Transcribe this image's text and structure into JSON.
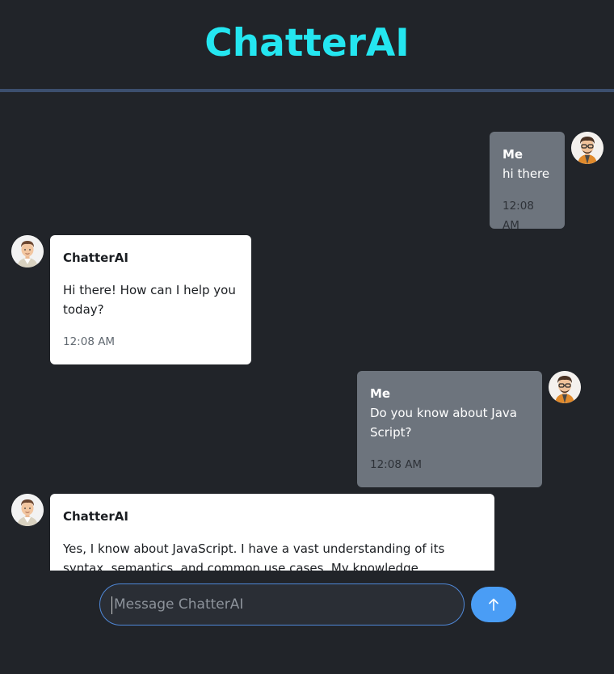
{
  "app": {
    "title": "ChatterAI"
  },
  "messages": [
    {
      "sender": "Me",
      "text": "hi there",
      "time": "12:08 AM",
      "role": "user"
    },
    {
      "sender": "ChatterAI",
      "text": "Hi there! How can I help you today?",
      "time": "12:08 AM",
      "role": "bot"
    },
    {
      "sender": "Me",
      "text": "Do you know about Java Script?",
      "time": "12:08 AM",
      "role": "user"
    },
    {
      "sender": "ChatterAI",
      "text": "Yes, I know about JavaScript. I have a vast understanding of its syntax, semantics, and common use cases. My knowledge encompasses:",
      "time": "",
      "role": "bot"
    }
  ],
  "composer": {
    "placeholder": "Message ChatterAI",
    "value": ""
  },
  "icons": {
    "send": "arrow-up-icon",
    "user_avatar": "user-avatar",
    "bot_avatar": "bot-avatar"
  },
  "colors": {
    "accent": "#24e6f0",
    "send_button": "#4a9df5",
    "user_bubble": "#6d747d",
    "bot_bubble": "#ffffff",
    "background": "#212429"
  }
}
